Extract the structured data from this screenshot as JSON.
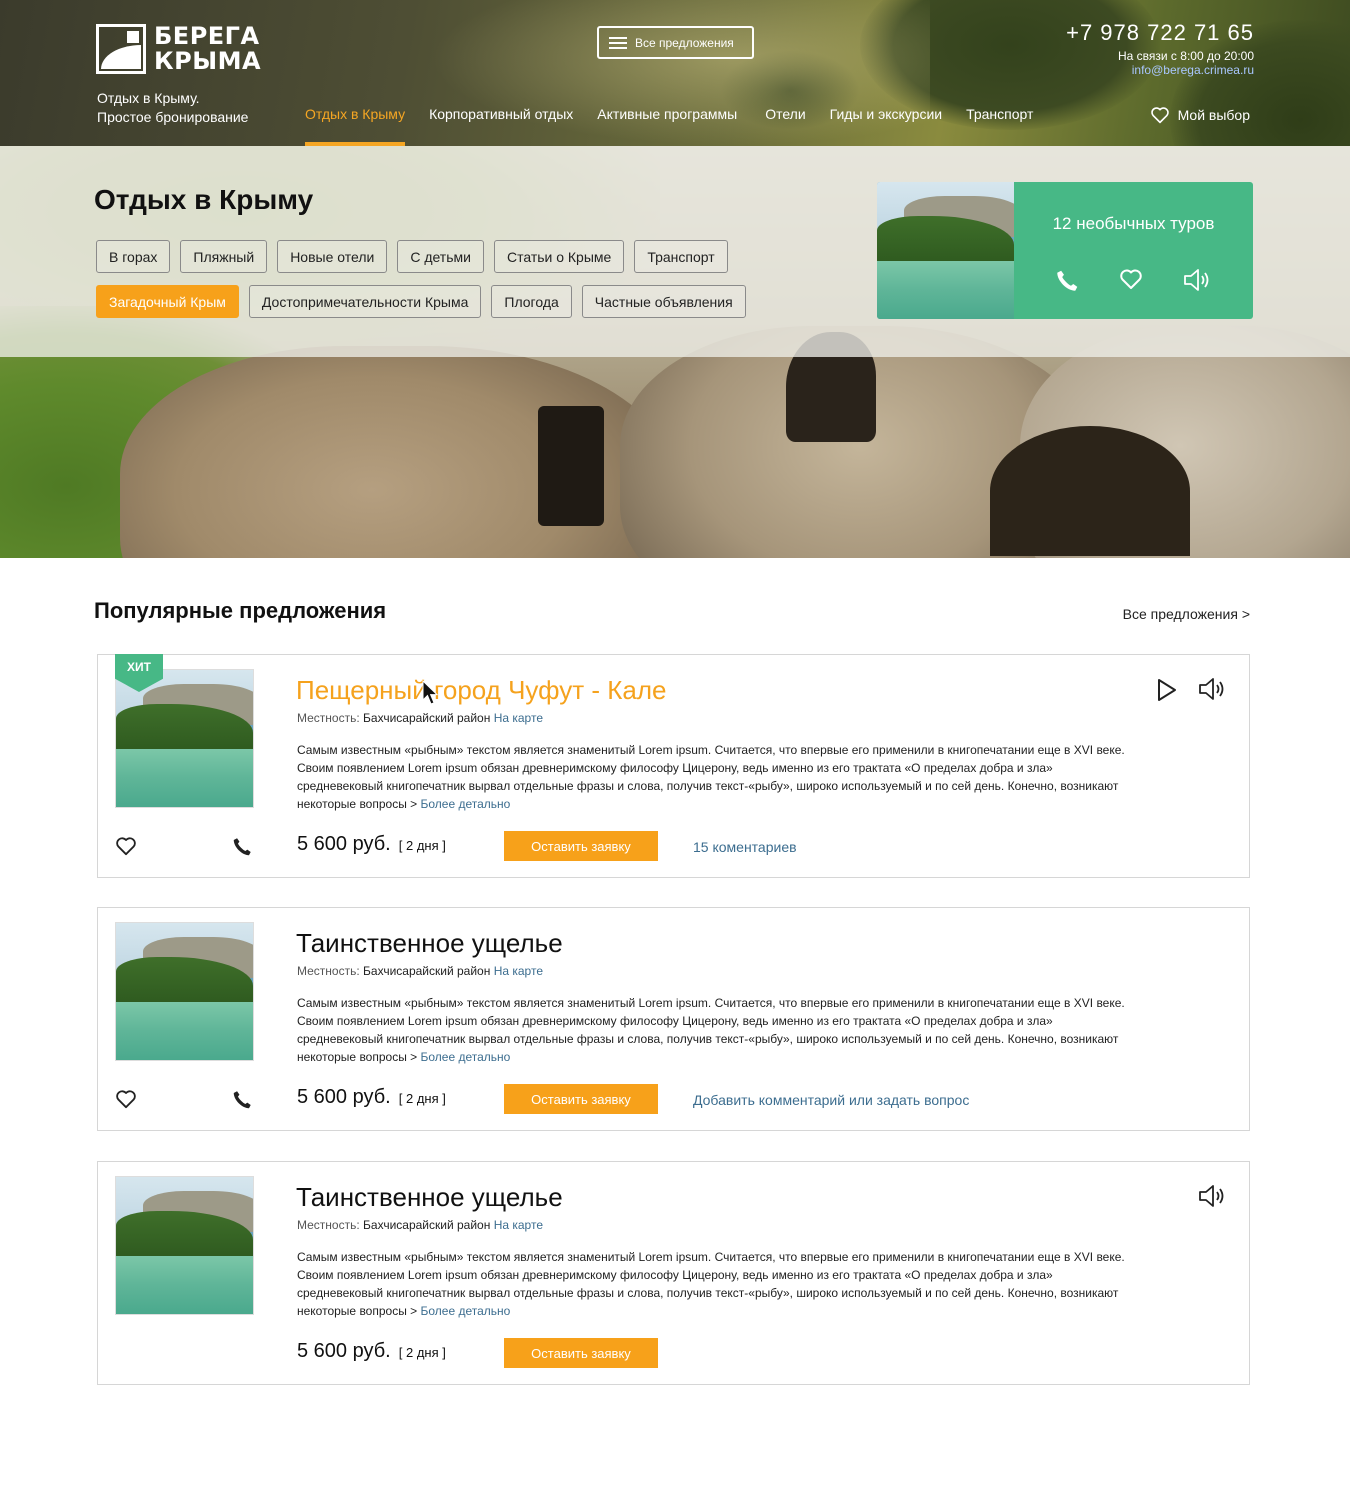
{
  "header": {
    "logo_line1": "БЕРЕГА",
    "logo_line2": "КРЫМА",
    "tagline_line1": "Отдых в Крыму.",
    "tagline_line2": "Простое бронирование",
    "all_offers_button": "Все предложения",
    "phone": "+7 978 722 71 65",
    "hours": "На связи с 8:00 до 20:00",
    "email": "info@berega.crimea.ru",
    "nav": [
      {
        "label": "Отдых в Крыму",
        "active": true
      },
      {
        "label": "Корпоративный отдых"
      },
      {
        "label": "Активные программы"
      },
      {
        "label": "Отели"
      },
      {
        "label": "Гиды и экскурсии"
      },
      {
        "label": "Транспорт"
      }
    ],
    "my_choice": "Мой выбор"
  },
  "hero": {
    "title": "Отдых в Крыму",
    "tags_row1": [
      "В горах",
      "Пляжный",
      "Новые отели",
      "С детьми",
      "Статьи о Крыме",
      "Транспорт"
    ],
    "tags_row2": [
      "Загадочный Крым",
      "Достопримечательности Крыма",
      "Плогода",
      "Частные объявления"
    ],
    "active_tag": "Загадочный Крым",
    "promo_title": "12 необычных туров"
  },
  "popular": {
    "title": "Популярные предложения",
    "see_all": "Все предложения >",
    "cards": [
      {
        "hit": "ХИТ",
        "title": "Пещерный город Чуфут - Кале",
        "loc_label": "Местность:",
        "loc_value": "Бахчисарайский район",
        "map_link": "На карте",
        "description": "Самым известным «рыбным» текстом является знаменитый Lorem ipsum. Считается, что впервые его применили в книгопечатании еще в XVI веке. Своим появлением Lorem ipsum обязан древнеримскому философу Цицерону, ведь именно из его трактата «О пределах добра и зла» средневековый книгопечатник вырвал отдельные фразы и слова, получив текст-«рыбу», широко используемый и по сей день. Конечно, возникают некоторые вопросы >",
        "more": "Более детально",
        "price": "5 600 руб.",
        "days": "[ 2 дня ]",
        "order": "Оставить заявку",
        "comments": "15 коментариев"
      },
      {
        "title": "Таинственное ущелье",
        "loc_label": "Местность:",
        "loc_value": "Бахчисарайский район",
        "map_link": "На карте",
        "description": "Самым известным «рыбным» текстом является знаменитый Lorem ipsum. Считается, что впервые его применили в книгопечатании еще в XVI веке. Своим появлением Lorem ipsum обязан древнеримскому философу Цицерону, ведь именно из его трактата «О пределах добра и зла» средневековый книгопечатник вырвал отдельные фразы и слова, получив текст-«рыбу», широко используемый и по сей день. Конечно, возникают некоторые вопросы >",
        "more": "Более детально",
        "price": "5 600 руб.",
        "days": "[ 2 дня ]",
        "order": "Оставить заявку",
        "comments": "Добавить комментарий или задать вопрос"
      },
      {
        "title": "Таинственное ущелье",
        "loc_label": "Местность:",
        "loc_value": "Бахчисарайский район",
        "map_link": "На карте",
        "description": "Самым известным «рыбным» текстом является знаменитый Lorem ipsum. Считается, что впервые его применили в книгопечатании еще в XVI веке. Своим появлением Lorem ipsum обязан древнеримскому философу Цицерону, ведь именно из его трактата «О пределах добра и зла» средневековый книгопечатник вырвал отдельные фразы и слова, получив текст-«рыбу», широко используемый и по сей день. Конечно, возникают некоторые вопросы >",
        "more": "Более детально",
        "price": "5 600 руб.",
        "days": "[ 2 дня ]",
        "order": "Оставить заявку"
      }
    ]
  },
  "icons": [
    "heart-icon",
    "phone-icon",
    "speaker-icon",
    "play-icon",
    "menu-icon",
    "cursor-icon"
  ],
  "colors": {
    "accent_orange": "#f7a11a",
    "promo_green": "#47b886",
    "link_blue": "#3c6d8f"
  }
}
